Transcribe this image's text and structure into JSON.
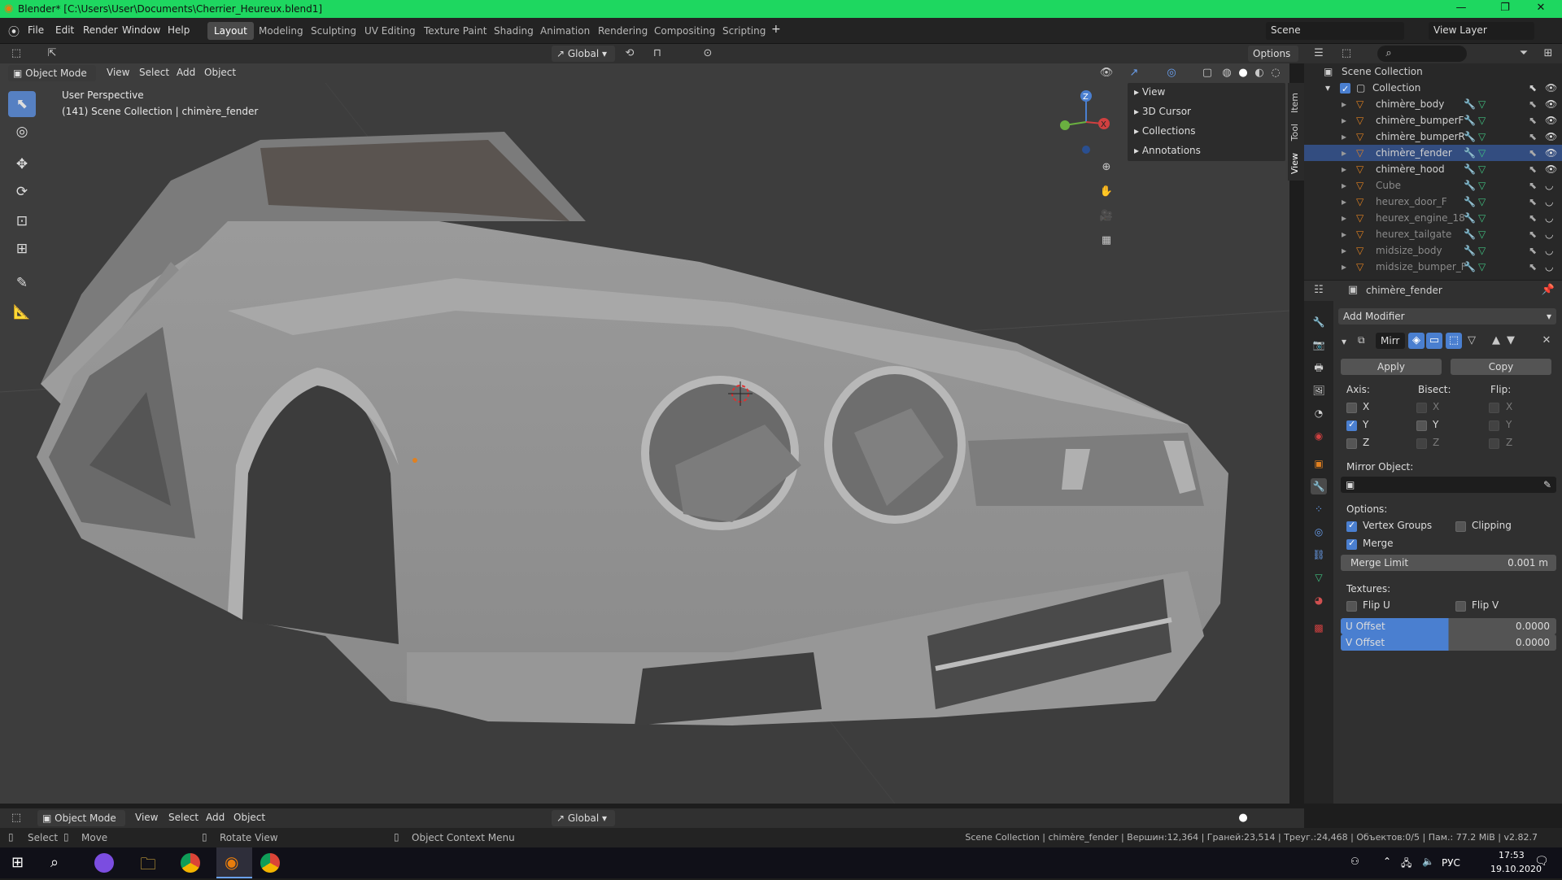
{
  "window": {
    "title": "Blender* [C:\\Users\\User\\Documents\\Cherrier_Heureux.blend1]"
  },
  "menu": [
    "File",
    "Edit",
    "Render",
    "Window",
    "Help"
  ],
  "workspaces": [
    "Layout",
    "Modeling",
    "Sculpting",
    "UV Editing",
    "Texture Paint",
    "Shading",
    "Animation",
    "Rendering",
    "Compositing",
    "Scripting"
  ],
  "scene": "Scene",
  "view_layer": "View Layer",
  "header": {
    "transform": "Global",
    "options": "Options",
    "mode": "Object Mode",
    "items": [
      "View",
      "Select",
      "Add",
      "Object"
    ]
  },
  "viewport": {
    "perspective": "User Perspective",
    "context": "(141) Scene Collection | chimère_fender"
  },
  "npanel": [
    "View",
    "3D Cursor",
    "Collections",
    "Annotations"
  ],
  "side_tabs": [
    "Item",
    "Tool",
    "View"
  ],
  "outliner": {
    "root": "Scene Collection",
    "collection": "Collection",
    "items": [
      {
        "name": "chimère_body",
        "dim": false
      },
      {
        "name": "chimère_bumperF",
        "dim": false
      },
      {
        "name": "chimère_bumperR",
        "dim": false
      },
      {
        "name": "chimère_fender",
        "dim": false
      },
      {
        "name": "chimère_hood",
        "dim": false
      },
      {
        "name": "Cube",
        "dim": true
      },
      {
        "name": "heurex_door_F",
        "dim": true
      },
      {
        "name": "heurex_engine_18",
        "dim": true
      },
      {
        "name": "heurex_tailgate",
        "dim": true
      },
      {
        "name": "midsize_body",
        "dim": true
      },
      {
        "name": "midsize_bumper_F",
        "dim": true
      }
    ]
  },
  "properties": {
    "object": "chimère_fender",
    "add_modifier": "Add Modifier",
    "modifier_name": "Mirr",
    "apply": "Apply",
    "copy": "Copy",
    "axis_label": "Axis:",
    "bisect_label": "Bisect:",
    "flip_label": "Flip:",
    "axes": [
      "X",
      "Y",
      "Z"
    ],
    "mirror_object": "Mirror Object:",
    "options": "Options:",
    "vertex_groups": "Vertex Groups",
    "clipping": "Clipping",
    "merge": "Merge",
    "merge_limit_label": "Merge Limit",
    "merge_limit": "0.001 m",
    "textures": "Textures:",
    "flip_u": "Flip U",
    "flip_v": "Flip V",
    "u_offset_label": "U Offset",
    "u_offset": "0.0000",
    "v_offset_label": "V Offset",
    "v_offset": "0.0000"
  },
  "status": {
    "select": "Select",
    "move": "Move",
    "rotate": "Rotate View",
    "context_menu": "Object Context Menu",
    "stats": "Scene Collection | chimère_fender | Вершин:12,364 | Граней:23,514 | Треуг.:24,468 | Объектов:0/5 | Пам.: 77.2 MiB | v2.82.7"
  },
  "taskbar": {
    "lang": "РУС",
    "time": "17:53",
    "date": "19.10.2020"
  }
}
